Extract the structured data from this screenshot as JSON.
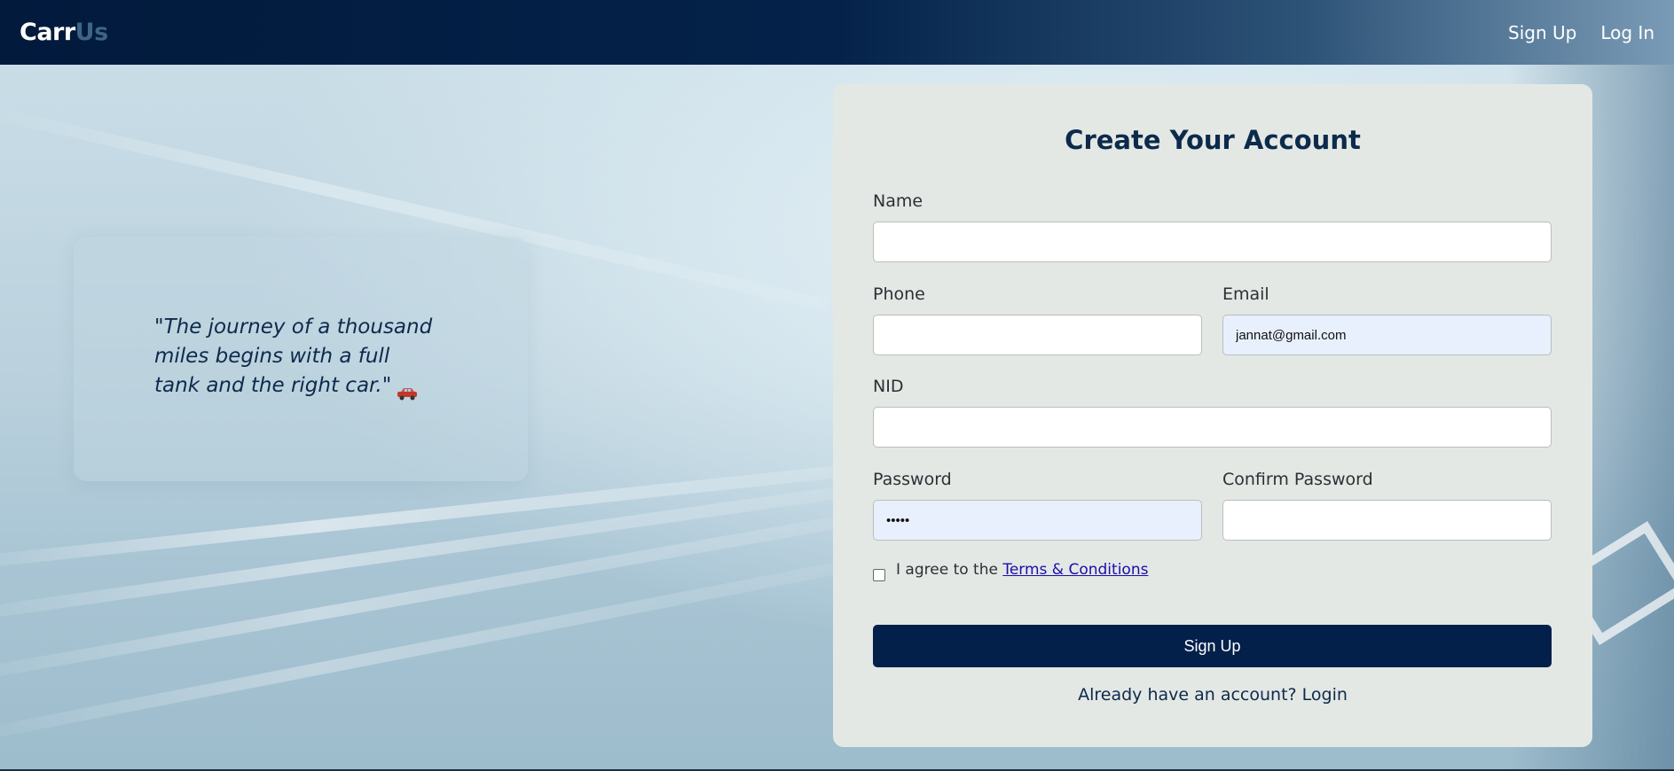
{
  "navbar": {
    "brand_part1": "Carr",
    "brand_part2": "Us",
    "links": [
      "Sign Up",
      "Log In"
    ]
  },
  "quote": {
    "text": "\"The journey of a thousand miles begins with a full tank and the right car.\"",
    "icon": "car-icon"
  },
  "form": {
    "title": "Create Your Account",
    "fields": {
      "name": {
        "label": "Name",
        "value": ""
      },
      "phone": {
        "label": "Phone",
        "value": ""
      },
      "email": {
        "label": "Email",
        "value": "jannat@gmail.com"
      },
      "nid": {
        "label": "NID",
        "value": ""
      },
      "password": {
        "label": "Password",
        "value": "•••••"
      },
      "confirm_password": {
        "label": "Confirm Password",
        "value": ""
      }
    },
    "agree_text": "I agree to the",
    "terms_link": "Terms & Conditions",
    "submit_label": "Sign Up",
    "login_prompt": "Already have an account? Login"
  },
  "colors": {
    "navy": "#02204a",
    "card_bg": "#e4e8e4",
    "autofill_bg": "#e8f0fe",
    "link": "#1a0dab"
  }
}
